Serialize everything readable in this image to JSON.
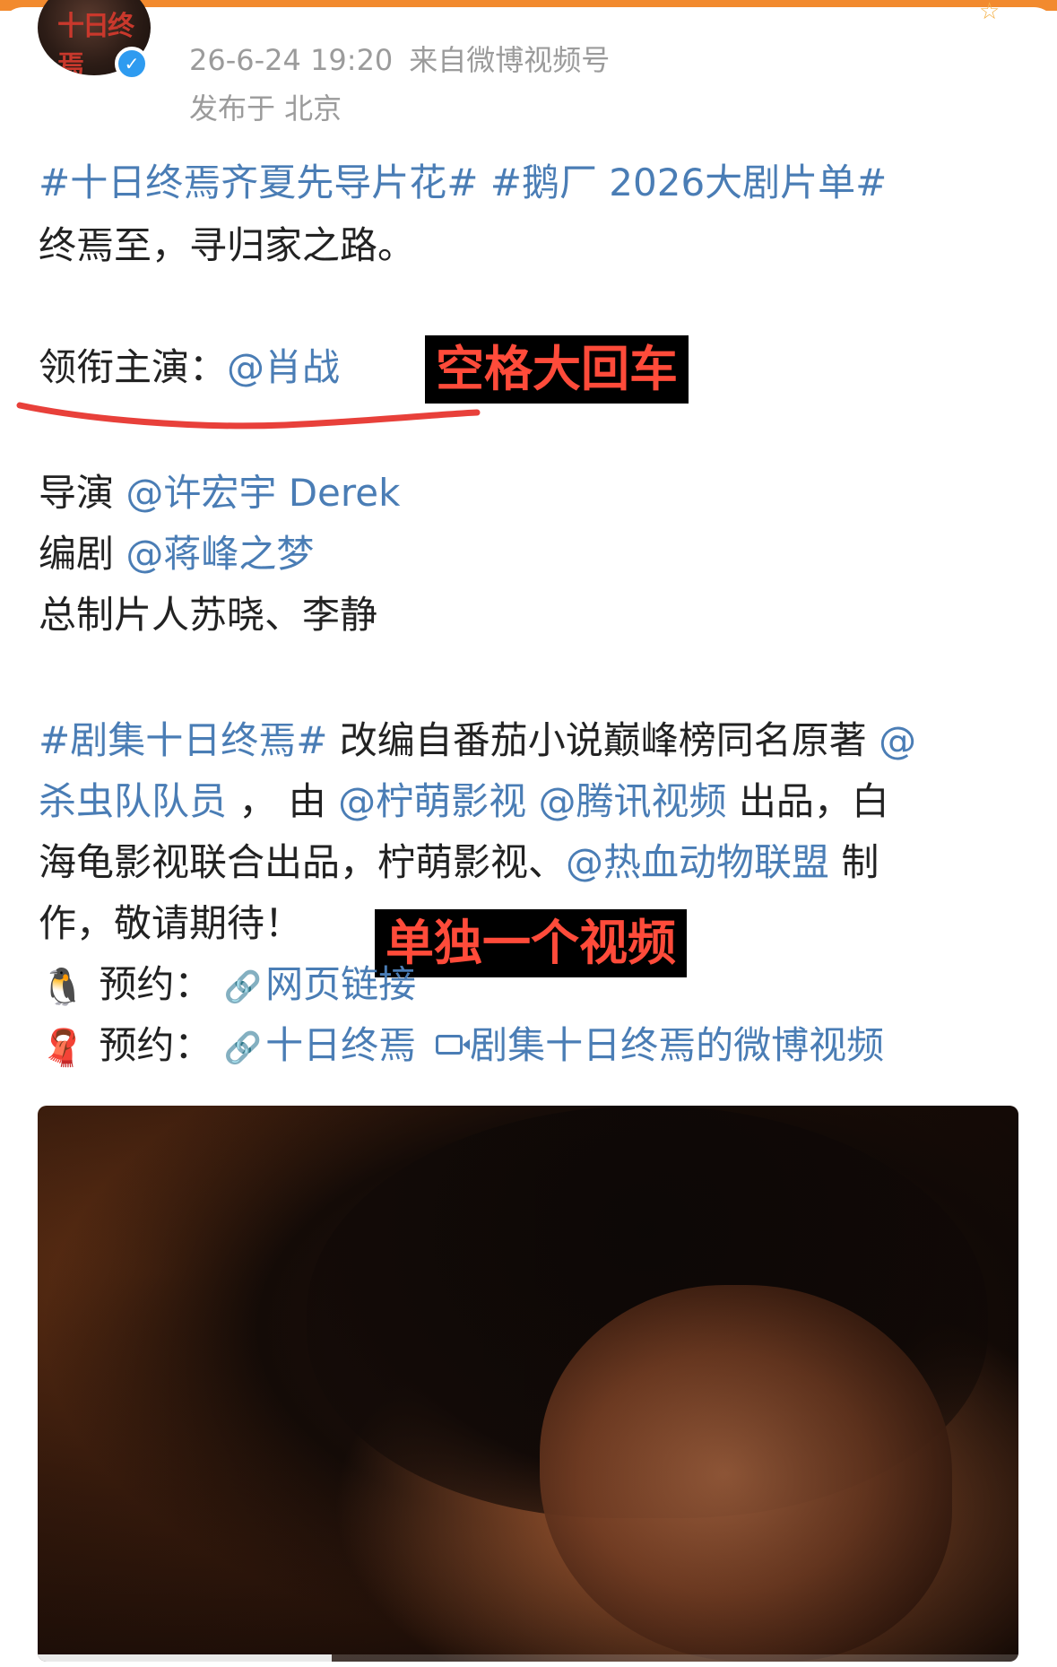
{
  "post": {
    "time": "26-6-24 19:20",
    "source": "来自微博视频号",
    "location": "发布于 北京"
  },
  "content": {
    "hashtag1": "#十日终焉齐夏先导片花#",
    "hashtag2": "#鹅厂 2026大剧片单#",
    "intro": "终焉至，寻归家之路。",
    "lead_label": "领衔主演：",
    "lead_mention": "@肖战",
    "director_label": "导演 ",
    "director_mention": "@许宏宇 Derek",
    "writer_label": "编剧 ",
    "writer_mention": "@蒋峰之梦",
    "producer": "总制片人苏晓、李静",
    "p1_tag": "#剧集十日终焉#",
    "p1_text": " 改编自番茄小说巅峰榜同名原著 ",
    "p1_mention": "@",
    "p2_mention_a": "杀虫队队员",
    "p2_text_a": " ， 由 ",
    "p2_mention_b": "@柠萌影视",
    "p2_space": " ",
    "p2_mention_c": "@腾讯视频",
    "p2_text_b": " 出品，白",
    "p3_text_a": "海龟影视联合出品，柠萌影视、",
    "p3_mention": "@热血动物联盟",
    "p3_text_b": " 制",
    "p4_text": "作，敬请期待！",
    "reserve1_label": "预约：",
    "reserve1_link": "网页链接",
    "reserve2_label": "预约：",
    "reserve2_link": "十日终焉",
    "reserve2_video": "剧集十日终焉的微博视频"
  },
  "annotations": {
    "note1": "空格大回车",
    "note2": "单独一个视频"
  },
  "icons": {
    "penguin": "🐧",
    "scarf": "🧣",
    "link": "🔗",
    "verified": "✓",
    "star": "☆"
  },
  "colors": {
    "link": "#4a7db5",
    "annotation_text": "#ff4b3a",
    "annotation_bg": "#000000",
    "top_bar": "#f28a2e",
    "meta": "#9b9b9b"
  },
  "video": {
    "progress": 0.3
  }
}
